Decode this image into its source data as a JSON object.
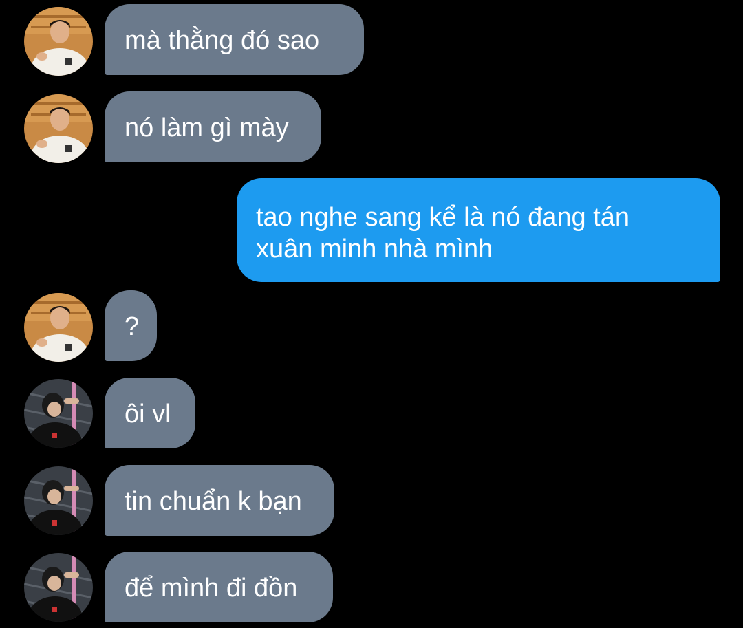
{
  "theme": {
    "background": "#000000",
    "incoming_bubble": "#6b7a8c",
    "outgoing_bubble": "#1d9bf0",
    "text": "#ffffff"
  },
  "messages": [
    {
      "direction": "incoming",
      "avatar": "avatar-a",
      "text": "mà thằng đó sao"
    },
    {
      "direction": "incoming",
      "avatar": "avatar-a",
      "text": "nó làm gì mày"
    },
    {
      "direction": "outgoing",
      "lines": [
        "tao nghe sang kể là nó đang tán",
        "xuân minh nhà mình"
      ]
    },
    {
      "direction": "incoming",
      "avatar": "avatar-a",
      "text": "?"
    },
    {
      "direction": "incoming",
      "avatar": "avatar-b",
      "text": "ôi vl"
    },
    {
      "direction": "incoming",
      "avatar": "avatar-b",
      "text": "tin chuẩn k bạn"
    },
    {
      "direction": "incoming",
      "avatar": "avatar-b",
      "text": "để mình đi đồn"
    }
  ]
}
